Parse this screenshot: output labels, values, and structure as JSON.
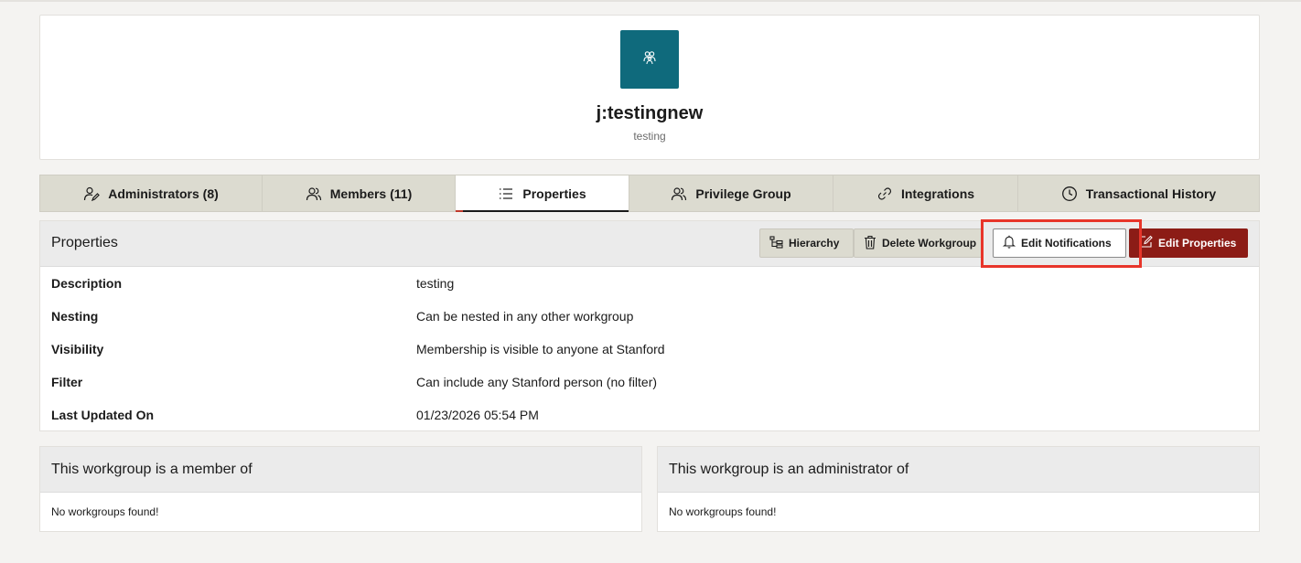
{
  "workgroup": {
    "title": "j:testingnew",
    "subtitle": "testing",
    "avatar_color": "#0f6a7c",
    "avatar_icon": "people-icon"
  },
  "tabs": [
    {
      "label": "Administrators (8)",
      "icon": "user-edit-icon",
      "active": false
    },
    {
      "label": "Members (11)",
      "icon": "users-icon",
      "active": false
    },
    {
      "label": "Properties",
      "icon": "list-icon",
      "active": true
    },
    {
      "label": "Privilege Group",
      "icon": "users-icon",
      "active": false
    },
    {
      "label": "Integrations",
      "icon": "link-icon",
      "active": false
    },
    {
      "label": "Transactional History",
      "icon": "clock-icon",
      "active": false
    }
  ],
  "properties": {
    "title": "Properties",
    "buttons": {
      "hierarchy": "Hierarchy",
      "delete": "Delete Workgroup",
      "notifications": "Edit Notifications",
      "edit": "Edit Properties"
    },
    "rows": [
      {
        "key": "Description",
        "value": "testing"
      },
      {
        "key": "Nesting",
        "value": "Can be nested in any other workgroup"
      },
      {
        "key": "Visibility",
        "value": "Membership is visible to anyone at Stanford"
      },
      {
        "key": "Filter",
        "value": "Can include any Stanford person (no filter)"
      },
      {
        "key": "Last Updated On",
        "value": "01/23/2026 05:54 PM"
      }
    ]
  },
  "member_of": {
    "title": "This workgroup is a member of",
    "empty": "No workgroups found!"
  },
  "admin_of": {
    "title": "This workgroup is an administrator of",
    "empty": "No workgroups found!"
  },
  "colors": {
    "accent": "#8c1c16",
    "highlight": "#e8352a",
    "tab_bg": "#dcdbd0"
  }
}
